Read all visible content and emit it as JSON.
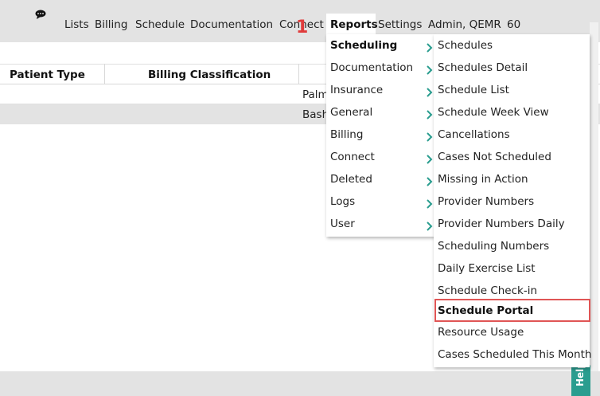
{
  "nav": {
    "items": [
      "Lists",
      "Billing",
      "Schedule",
      "Documentation",
      "Connect",
      "Reports",
      "Settings",
      "Admin, QEMR",
      "60"
    ],
    "step_marker": "1"
  },
  "table": {
    "headers": [
      "Patient Type",
      "Billing Classification"
    ],
    "rows": [
      {
        "cell3": "Palm"
      },
      {
        "cell3": "Bash"
      }
    ]
  },
  "reports_menu": {
    "items": [
      "Scheduling",
      "Documentation",
      "Insurance",
      "General",
      "Billing",
      "Connect",
      "Deleted",
      "Logs",
      "User"
    ]
  },
  "scheduling_submenu": {
    "items": [
      "Schedules",
      "Schedules Detail",
      "Schedule List",
      "Schedule Week View",
      "Cancellations",
      "Cases Not Scheduled",
      "Missing in Action",
      "Provider Numbers",
      "Provider Numbers Daily",
      "Scheduling Numbers",
      "Daily Exercise List",
      "Schedule Check-in",
      "Schedule Portal",
      "Resource Usage",
      "Cases Scheduled This Month"
    ]
  },
  "help": {
    "label": "Help"
  },
  "colors": {
    "accent": "#2a9d8f",
    "highlight": "#e05555",
    "bar": "#e3e3e3"
  }
}
